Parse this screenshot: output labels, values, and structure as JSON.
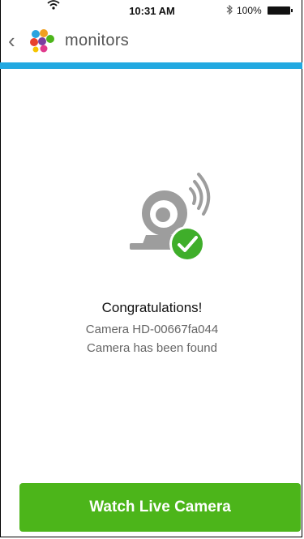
{
  "status_bar": {
    "wifi_icon": "wifi-icon",
    "time": "10:31 AM",
    "bluetooth_icon": "bluetooth-icon",
    "battery_percent": "100%",
    "battery_icon": "battery-icon"
  },
  "nav": {
    "back_icon": "chevron-left-icon",
    "logo_icon": "app-logo-icon",
    "title": "monitors"
  },
  "colors": {
    "accent_bar": "#22a9e1",
    "primary_button": "#4cb51a",
    "check_badge": "#3fae2a",
    "camera_gray": "#9d9d9d"
  },
  "content": {
    "illustration_icon": "camera-found-icon",
    "title": "Congratulations!",
    "camera_id_line": "Camera HD-00667fa044",
    "status_line": "Camera has been found"
  },
  "footer": {
    "watch_button_label": "Watch Live Camera"
  }
}
